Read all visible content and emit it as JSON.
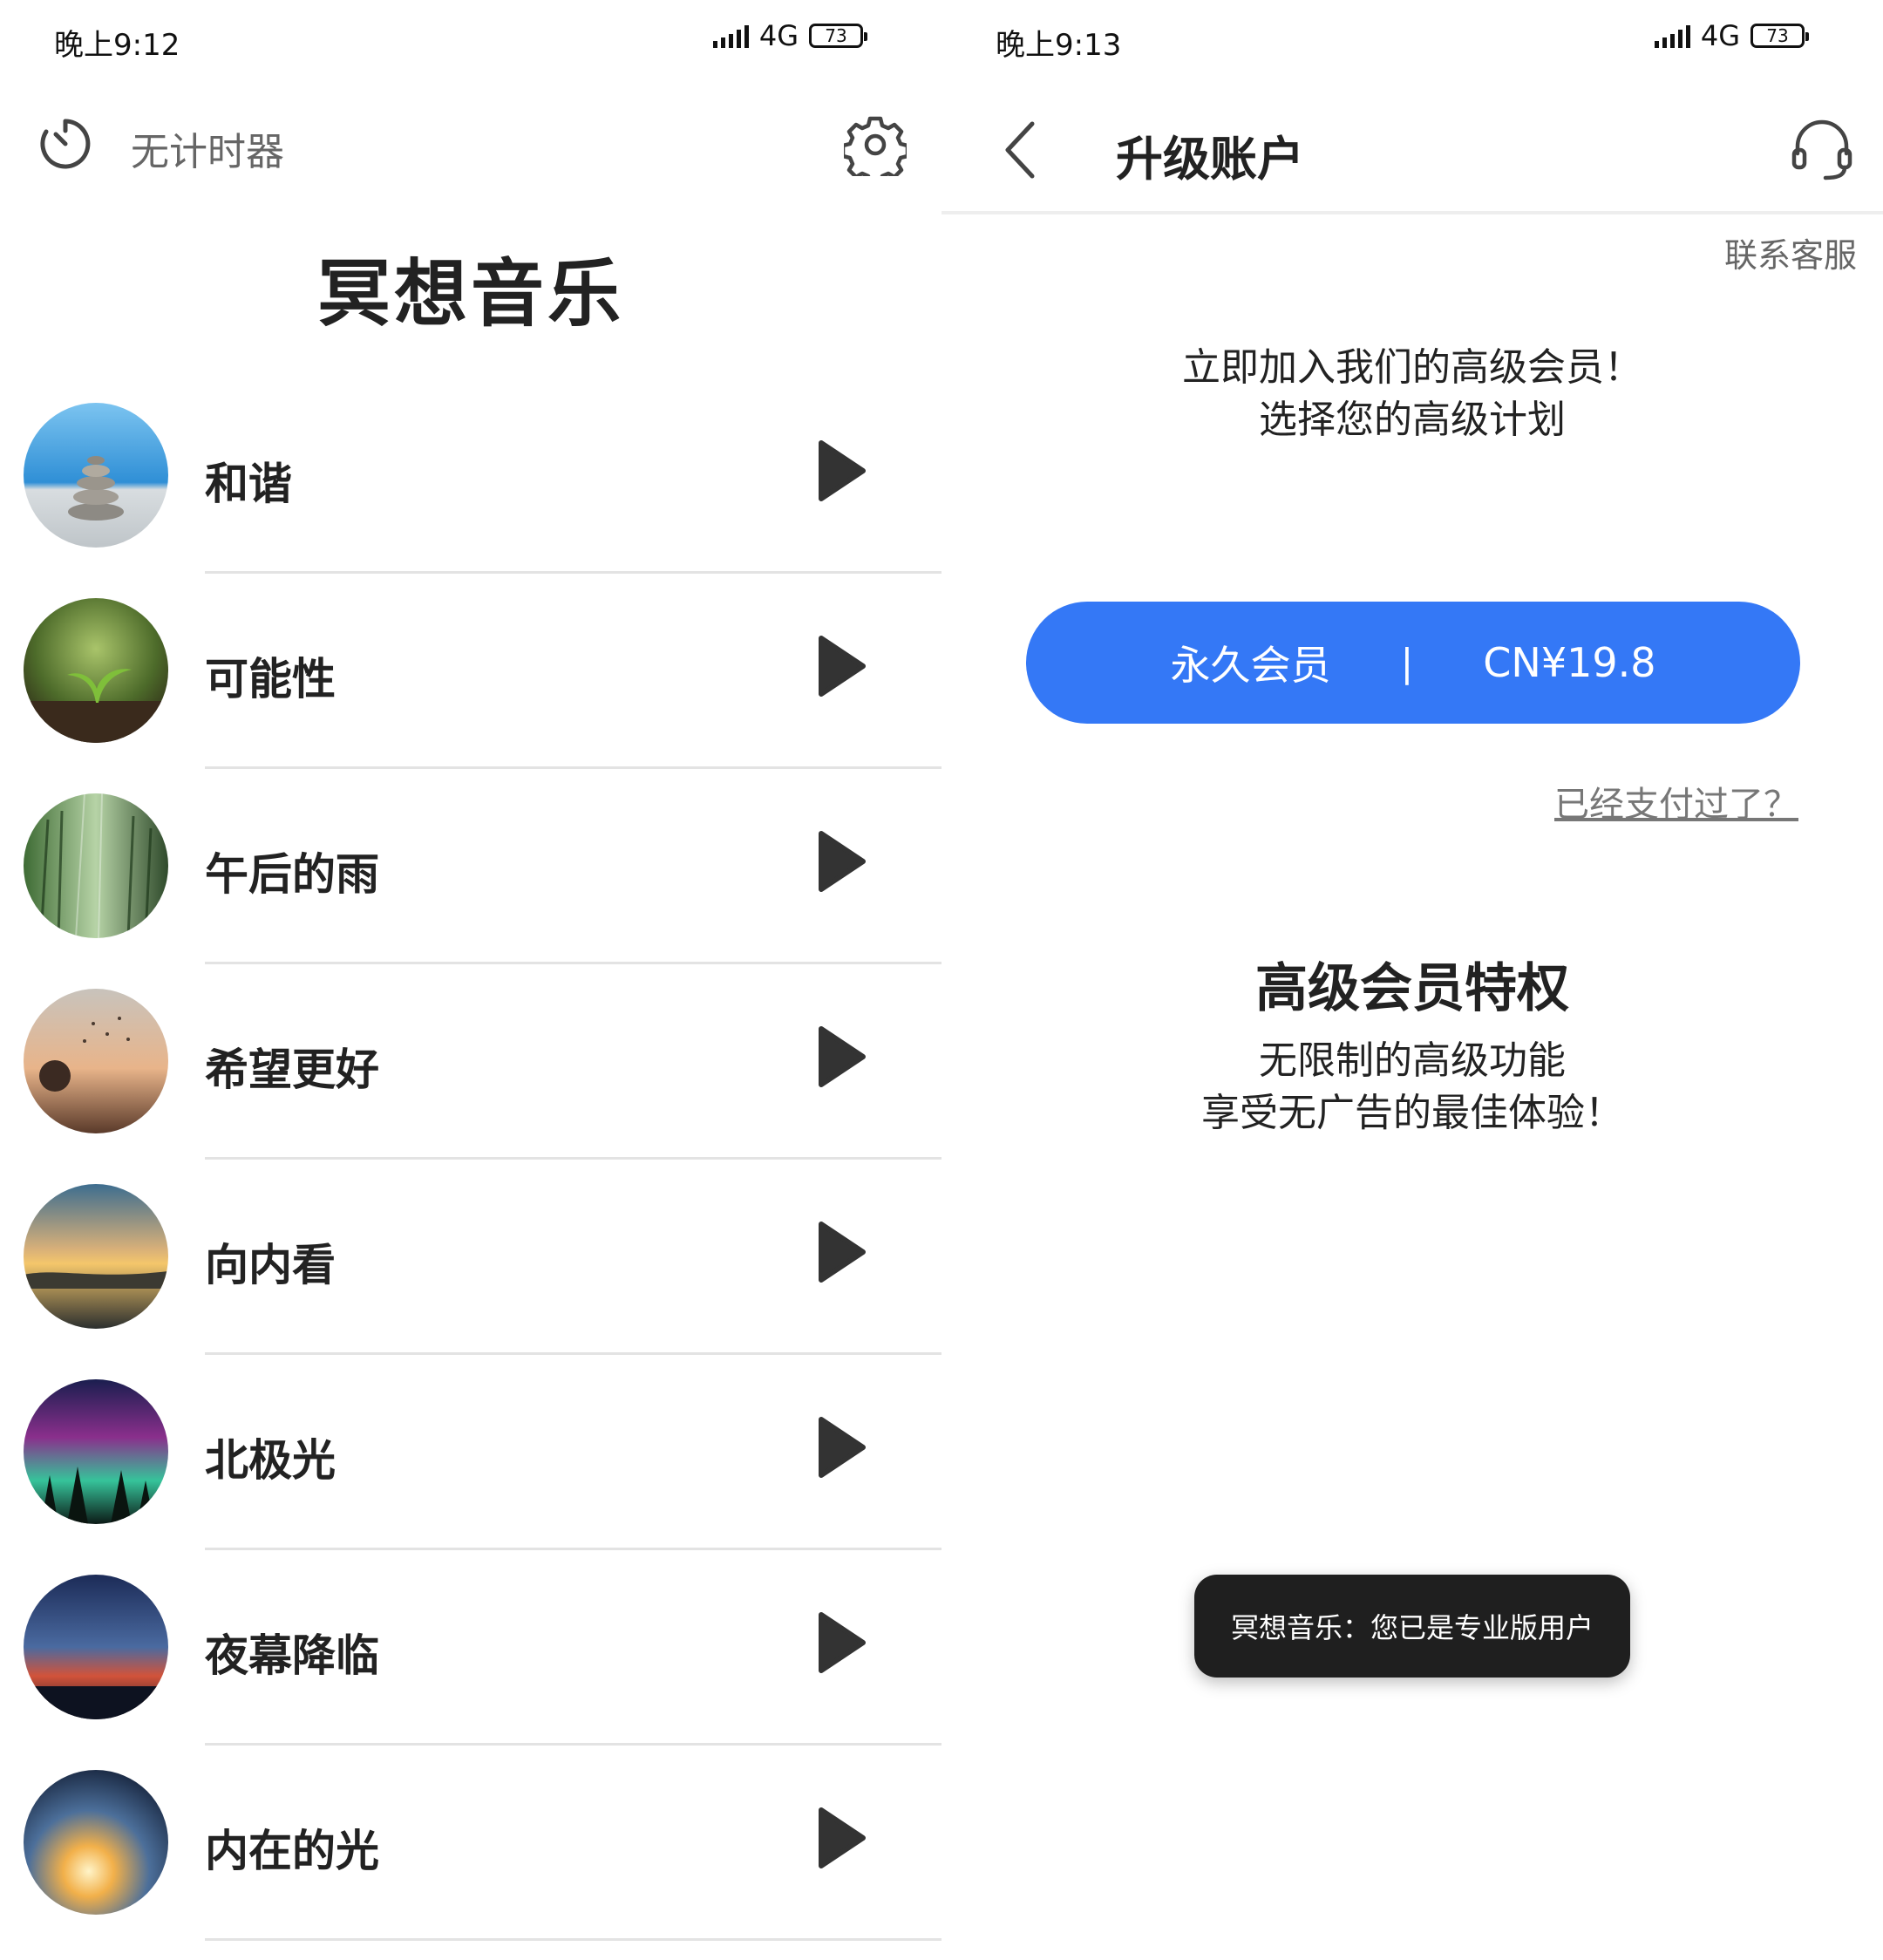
{
  "left_screen": {
    "status_bar": {
      "time": "晚上9:12",
      "network": "4G",
      "battery": "73"
    },
    "toolbar": {
      "timer_label": "无计时器"
    },
    "title": "冥想音乐",
    "tracks": [
      {
        "name": "和谐"
      },
      {
        "name": "可能性"
      },
      {
        "name": "午后的雨"
      },
      {
        "name": "希望更好"
      },
      {
        "name": "向内看"
      },
      {
        "name": "北极光"
      },
      {
        "name": "夜幕降临"
      },
      {
        "name": "内在的光"
      }
    ]
  },
  "right_screen": {
    "status_bar": {
      "time": "晚上9:13",
      "network": "4G",
      "battery": "73"
    },
    "header": {
      "title": "升级账户"
    },
    "contact_label": "联系客服",
    "intro_line1": "立即加入我们的高级会员！",
    "intro_line2": "选择您的高级计划",
    "plan": {
      "name": "永久会员",
      "separator": "|",
      "price": "CN¥19.8"
    },
    "already_paid_link": "已经支付过了？",
    "privileges": {
      "title": "高级会员特权",
      "line1": "无限制的高级功能",
      "line2": "享受无广告的最佳体验！"
    },
    "toast": "冥想音乐：您已是专业版用户"
  },
  "colors": {
    "accent": "#3478f6",
    "toast_bg": "#1f1f1f",
    "divider": "#e3e3e3"
  },
  "icons": [
    "timer-icon",
    "gear-icon",
    "play-icon",
    "back-icon",
    "headset-icon"
  ]
}
